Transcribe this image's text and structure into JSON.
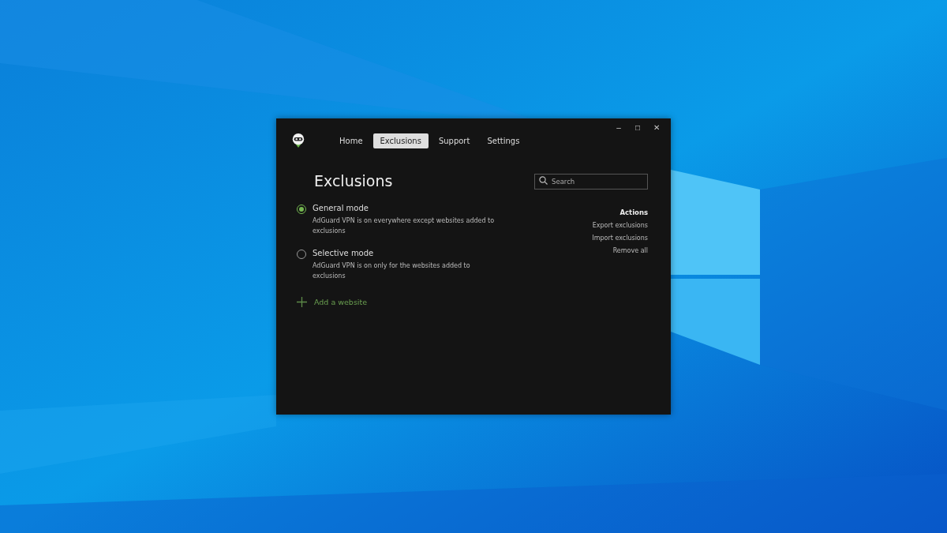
{
  "window": {
    "controls": [
      "–",
      "□",
      "✕"
    ]
  },
  "tabs": [
    {
      "label": "Home",
      "selected": false
    },
    {
      "label": "Exclusions",
      "selected": true
    },
    {
      "label": "Support",
      "selected": false
    },
    {
      "label": "Settings",
      "selected": false
    }
  ],
  "page_title": "Exclusions",
  "search": {
    "placeholder": "Search"
  },
  "modes": [
    {
      "label": "General mode",
      "description": "AdGuard VPN is on everywhere except websites added to exclusions",
      "selected": true
    },
    {
      "label": "Selective mode",
      "description": "AdGuard VPN is on only for the websites added to exclusions",
      "selected": false
    }
  ],
  "add_website": "Add a website",
  "actions": {
    "title": "Actions",
    "items": [
      "Export exclusions",
      "Import exclusions",
      "Remove all"
    ]
  }
}
